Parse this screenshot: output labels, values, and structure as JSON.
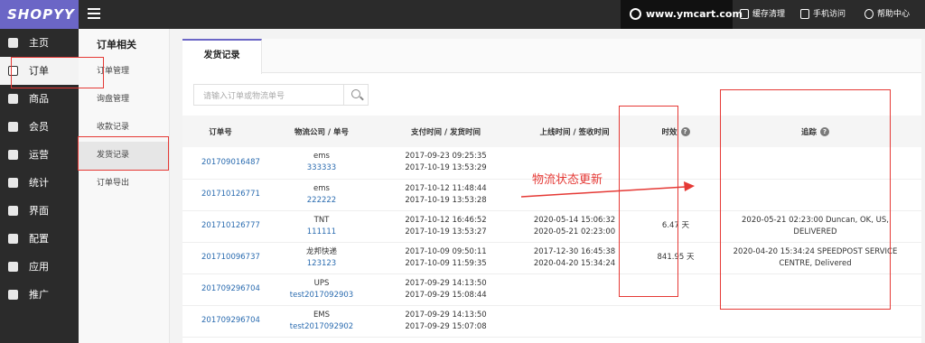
{
  "header": {
    "logo": "SHOPYY",
    "site": "www.ymcart.com",
    "actions": [
      "缓存清理",
      "手机访问",
      "帮助中心"
    ]
  },
  "sidebar": {
    "items": [
      {
        "label": "主页",
        "icon": "home-icon"
      },
      {
        "label": "订单",
        "icon": "order-icon"
      },
      {
        "label": "商品",
        "icon": "box-icon"
      },
      {
        "label": "会员",
        "icon": "users-icon"
      },
      {
        "label": "运营",
        "icon": "megaphone-icon"
      },
      {
        "label": "统计",
        "icon": "bar-chart-icon"
      },
      {
        "label": "界面",
        "icon": "window-icon"
      },
      {
        "label": "配置",
        "icon": "gear-icon"
      },
      {
        "label": "应用",
        "icon": "puzzle-icon"
      },
      {
        "label": "推广",
        "icon": "send-icon"
      }
    ]
  },
  "subnav": {
    "title": "订单相关",
    "items": [
      "订单管理",
      "询盘管理",
      "收款记录",
      "发货记录",
      "订单导出"
    ]
  },
  "tab": "发货记录",
  "search": {
    "placeholder": "请输入订单或物流单号"
  },
  "table": {
    "headers": [
      "订单号",
      "物流公司 / 单号",
      "支付时间 / 发货时间",
      "上线时间 / 签收时间",
      "时效",
      "追踪"
    ],
    "rows": [
      {
        "order": "201709016487",
        "carrier": "ems",
        "tracking": "333333",
        "pay": "2017-09-23 09:25:35",
        "ship": "2017-10-19 13:53:29",
        "online": "",
        "signed": "",
        "aging": "",
        "trace": ""
      },
      {
        "order": "201710126771",
        "carrier": "ems",
        "tracking": "222222",
        "pay": "2017-10-12 11:48:44",
        "ship": "2017-10-19 13:53:28",
        "online": "",
        "signed": "",
        "aging": "",
        "trace": ""
      },
      {
        "order": "201710126777",
        "carrier": "TNT",
        "tracking": "111111",
        "pay": "2017-10-12 16:46:52",
        "ship": "2017-10-19 13:53:27",
        "online": "2020-05-14 15:06:32",
        "signed": "2020-05-21 02:23:00",
        "aging": "6.47 天",
        "trace": "2020-05-21 02:23:00 Duncan, OK, US, DELIVERED"
      },
      {
        "order": "201710096737",
        "carrier": "龙邦快递",
        "tracking": "123123",
        "pay": "2017-10-09 09:50:11",
        "ship": "2017-10-09 11:59:35",
        "online": "2017-12-30 16:45:38",
        "signed": "2020-04-20 15:34:24",
        "aging": "841.95 天",
        "trace": "2020-04-20 15:34:24 SPEEDPOST SERVICE CENTRE, Delivered"
      },
      {
        "order": "201709296704",
        "carrier": "UPS",
        "tracking": "test2017092903",
        "pay": "2017-09-29 14:13:50",
        "ship": "2017-09-29 15:08:44",
        "online": "",
        "signed": "",
        "aging": "",
        "trace": ""
      },
      {
        "order": "201709296704",
        "carrier": "EMS",
        "tracking": "test2017092902",
        "pay": "2017-09-29 14:13:50",
        "ship": "2017-09-29 15:07:08",
        "online": "",
        "signed": "",
        "aging": "",
        "trace": ""
      }
    ]
  },
  "annotation": {
    "label": "物流状态更新",
    "color": "#e53935"
  }
}
